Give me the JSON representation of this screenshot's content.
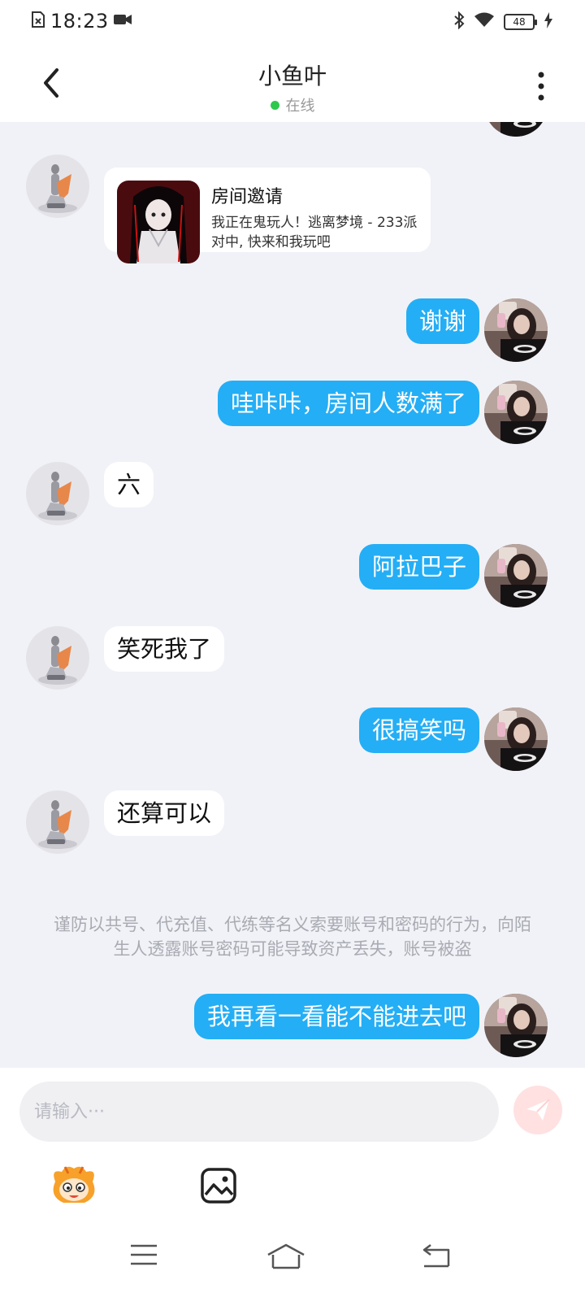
{
  "status_bar": {
    "time": "18:23",
    "battery": "48"
  },
  "header": {
    "title": "小鱼叶",
    "online_status": "在线"
  },
  "invite": {
    "title": "房间邀请",
    "description": "我正在鬼玩人！逃离梦境 - 233派对中, 快来和我玩吧"
  },
  "messages": [
    {
      "side": "out",
      "text": "谢谢"
    },
    {
      "side": "out",
      "text": "哇咔咔，房间人数满了"
    },
    {
      "side": "in",
      "text": "六"
    },
    {
      "side": "out",
      "text": "阿拉巴子"
    },
    {
      "side": "in",
      "text": "笑死我了"
    },
    {
      "side": "out",
      "text": "很搞笑吗"
    },
    {
      "side": "in",
      "text": "还算可以"
    },
    {
      "side": "out",
      "text": "我再看一看能不能进去吧"
    }
  ],
  "notice": "谨防以共号、代充值、代练等名义索要账号和密码的行为，向陌生人透露账号密码可能导致资产丢失，账号被盗",
  "input": {
    "placeholder": "请输入···",
    "value": ""
  },
  "colors": {
    "outgoing_bubble": "#24aef5",
    "incoming_bubble": "#ffffff",
    "chat_background": "#f1f2f7",
    "online_dot": "#2dc84d",
    "send_button": "#ffe1e1"
  },
  "icons": {
    "back": "chevron-left-icon",
    "more": "more-vertical-icon",
    "send": "send-icon",
    "emoji": "emoji-mascot-icon",
    "image": "image-icon"
  }
}
